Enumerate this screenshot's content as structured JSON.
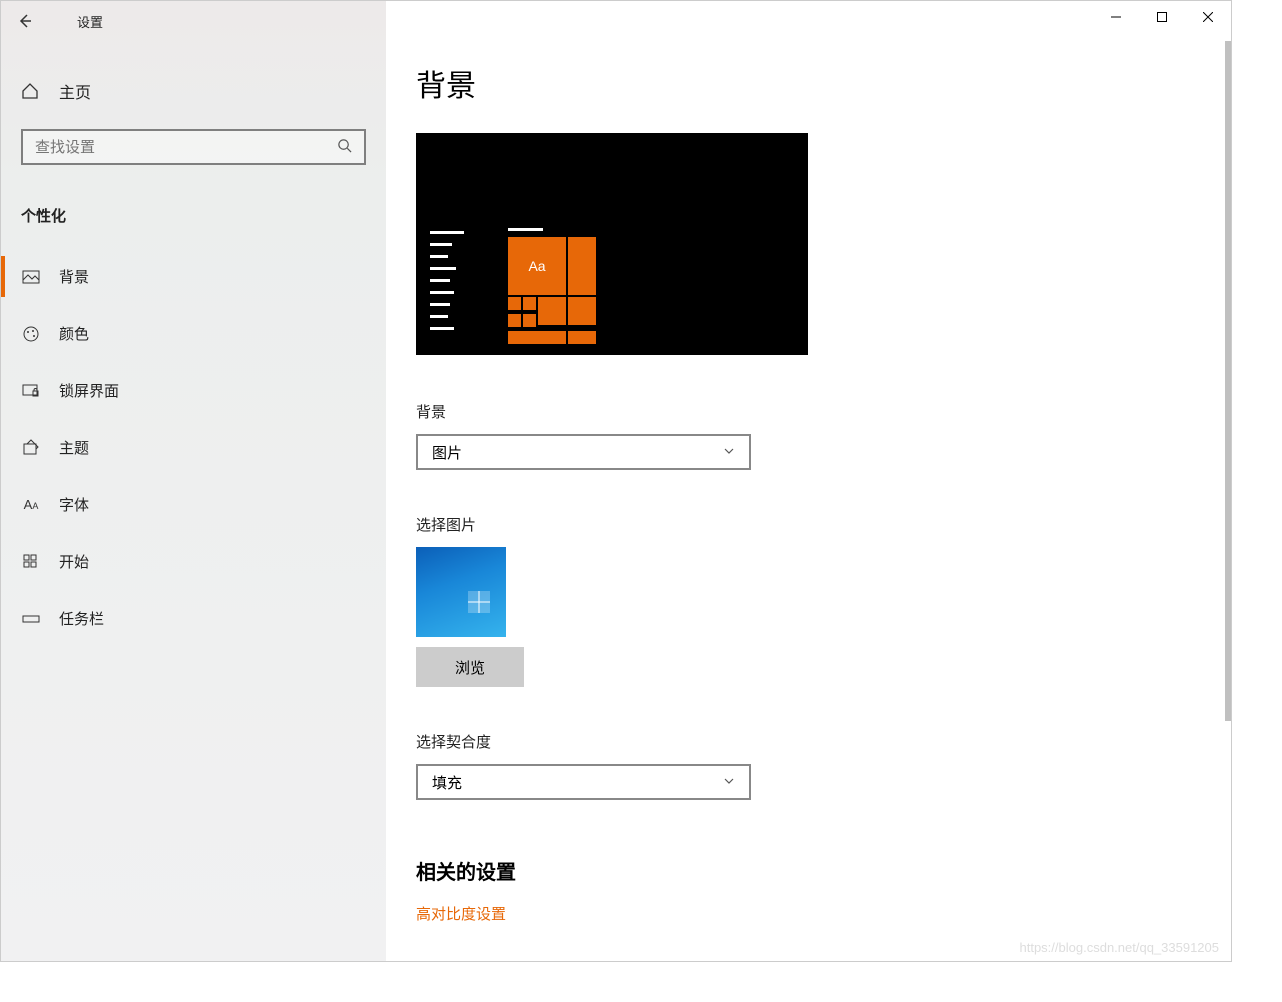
{
  "window": {
    "title": "设置",
    "watermark": "https://blog.csdn.net/qq_33591205"
  },
  "sidebar": {
    "home_label": "主页",
    "search_placeholder": "查找设置",
    "category": "个性化",
    "items": [
      {
        "label": "背景",
        "icon": "image"
      },
      {
        "label": "颜色",
        "icon": "palette"
      },
      {
        "label": "锁屏界面",
        "icon": "lockscreen"
      },
      {
        "label": "主题",
        "icon": "theme"
      },
      {
        "label": "字体",
        "icon": "font"
      },
      {
        "label": "开始",
        "icon": "start"
      },
      {
        "label": "任务栏",
        "icon": "taskbar"
      }
    ],
    "active_index": 0
  },
  "main": {
    "page_title": "背景",
    "preview_sample_text": "Aa",
    "background_label": "背景",
    "background_value": "图片",
    "choose_picture_label": "选择图片",
    "browse_button": "浏览",
    "fit_label": "选择契合度",
    "fit_value": "填充",
    "related_title": "相关的设置",
    "related_link": "高对比度设置"
  }
}
